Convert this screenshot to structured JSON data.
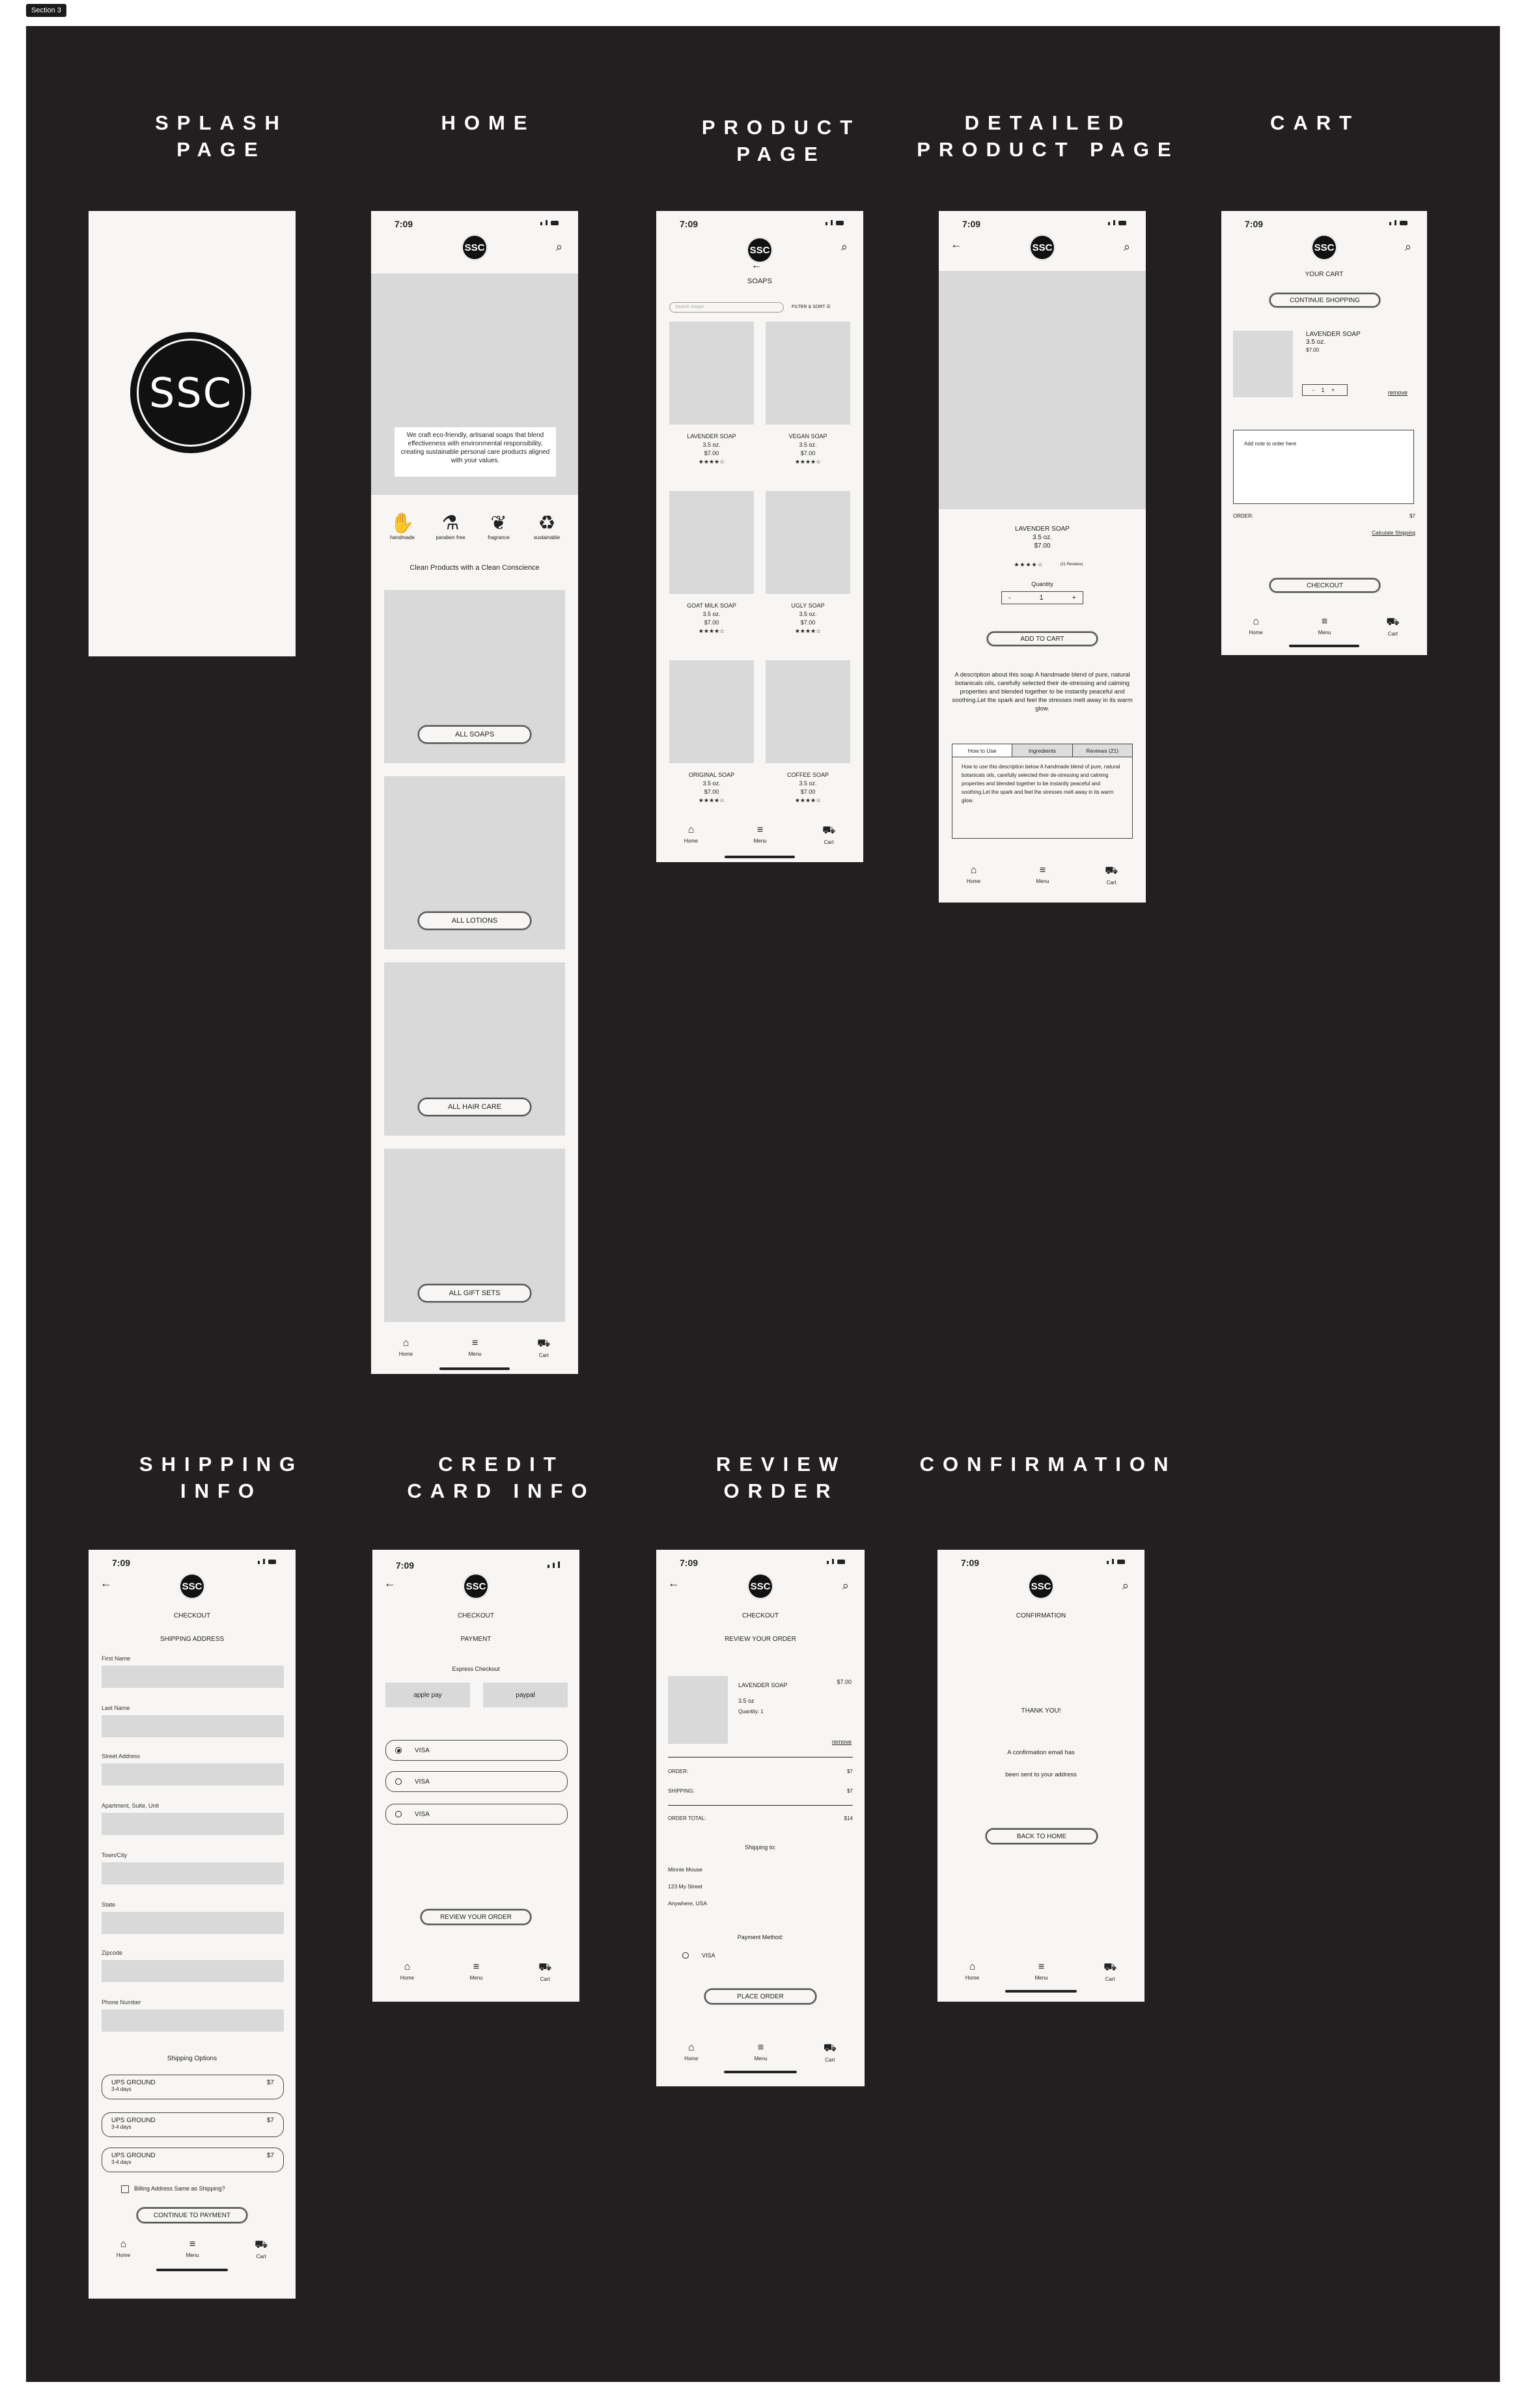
{
  "section_tag": "Section 3",
  "brand": "SSC",
  "time": "7:09",
  "titles": {
    "splash": "SPLASH\nPAGE",
    "home": "HOME",
    "product": "PRODUCT\nPAGE",
    "detailed": "DETAILED\nPRODUCT PAGE",
    "cart": "CART",
    "shipping": "SHIPPING\nINFO",
    "credit": "CREDIT\nCARD INFO",
    "review": "REVIEW\nORDER",
    "confirmation": "CONFIRMATION"
  },
  "nav": {
    "home": "Home",
    "menu": "Menu",
    "cart": "Cart"
  },
  "home": {
    "hero_text": "We craft eco-friendly, artisanal soaps that blend effectiveness with environmental responsibility, creating sustainable personal care products aligned with your values.",
    "features": [
      "handmade",
      "paraben free",
      "fragrance",
      "sustainable"
    ],
    "tagline": "Clean Products with a Clean Conscience",
    "categories": [
      "ALL SOAPS",
      "ALL LOTIONS",
      "ALL HAIR CARE",
      "ALL GIFT SETS"
    ]
  },
  "product": {
    "heading": "SOAPS",
    "search_placeholder": "Search Soaps",
    "filter": "FILTER & SORT",
    "items": [
      {
        "name": "LAVENDER SOAP",
        "size": "3.5 oz.",
        "price": "$7.00",
        "stars": "★★★★☆"
      },
      {
        "name": "VEGAN SOAP",
        "size": "3.5 oz.",
        "price": "$7.00",
        "stars": "★★★★☆"
      },
      {
        "name": "GOAT MILK SOAP",
        "size": "3.5 oz.",
        "price": "$7.00",
        "stars": "★★★★☆"
      },
      {
        "name": "UGLY SOAP",
        "size": "3.5 oz.",
        "price": "$7.00",
        "stars": "★★★★☆"
      },
      {
        "name": "ORIGINAL SOAP",
        "size": "3.5 oz.",
        "price": "$7.00",
        "stars": "★★★★☆"
      },
      {
        "name": "COFFEE SOAP",
        "size": "3.5 oz.",
        "price": "$7.00",
        "stars": "★★★★☆"
      }
    ]
  },
  "detail": {
    "name": "LAVENDER SOAP",
    "size": "3.5 oz.",
    "price": "$7.00",
    "stars": "★★★★☆",
    "reviews": "(21 Reviews)",
    "quantity_label": "Quantity",
    "minus": "-",
    "qty": "1",
    "plus": "+",
    "add_to_cart": "ADD TO CART",
    "description": "A description about this soap A handmade blend of pure, natural botanicals oils, carefully selected their de-stressing and calming properties and blended together to be instantly peaceful and soothing.Let the spark and feel the stresses melt away in its warm glow.",
    "tabs": [
      "How to Use",
      "Ingredients",
      "Reviews (21)"
    ],
    "tab_content": "How to use this description below A handmade blend of pure, natural botanicals oils, carefully selected their de-stressing and calming properties and blended together to be instantly peaceful and soothing.Let the spark and feel the stresses melt away in its warm glow."
  },
  "cart": {
    "heading": "YOUR CART",
    "continue": "CONTINUE SHOPPING",
    "item_name": "LAVENDER SOAP",
    "item_size": "3.5 oz.",
    "item_price": "$7.00",
    "qty": "- 1 +",
    "remove": "remove",
    "note_placeholder": "Add note to order here",
    "order_label": "ORDER:",
    "order_value": "$7",
    "calc_shipping": "Calculate Shipping",
    "checkout": "CHECKOUT"
  },
  "shipping": {
    "heading": "CHECKOUT",
    "sub": "SHIPPING ADDRESS",
    "fields": [
      "First Name",
      "Last Name",
      "Street Address",
      "Apartment, Suite, Unit",
      "Town/City",
      "State",
      "Zipcode",
      "Phone Number"
    ],
    "options_label": "Shipping Options",
    "options": [
      {
        "name": "UPS GROUND",
        "days": "3-4 days",
        "price": "$7"
      },
      {
        "name": "UPS GROUND",
        "days": "3-4 days",
        "price": "$7"
      },
      {
        "name": "UPS GROUND",
        "days": "3-4 days",
        "price": "$7"
      }
    ],
    "billing": "Billing Address Same as Shipping?",
    "continue": "CONTINUE TO PAYMENT"
  },
  "credit": {
    "heading": "CHECKOUT",
    "sub": "PAYMENT",
    "express": "Express Checkout",
    "apple": "apple pay",
    "paypal": "paypal",
    "cards": [
      "VISA",
      "VISA",
      "VISA"
    ],
    "review": "REVIEW YOUR ORDER"
  },
  "review": {
    "heading": "CHECKOUT",
    "sub": "REVIEW YOUR ORDER",
    "item_name": "LAVENDER SOAP",
    "item_size": "3.5 oz",
    "item_qty": "Quantity: 1",
    "item_price": "$7.00",
    "remove": "remove",
    "order_label": "ORDER:",
    "order_value": "$7",
    "shipping_label": "SHIPPING:",
    "shipping_value": "$7",
    "total_label": "ORDER TOTAL:",
    "total_value": "$14",
    "ship_to": "Shipping to:",
    "address": [
      "Minnie Mouse",
      "123 My Street",
      "Anywhere, USA"
    ],
    "payment_method": "Payment Method:",
    "card": "VISA",
    "place_order": "PLACE ORDER"
  },
  "confirmation": {
    "heading": "CONFIRMATION",
    "thanks": "THANK YOU!",
    "line1": "A confirmation email has",
    "line2": "been sent to your address",
    "back": "BACK TO HOME"
  }
}
